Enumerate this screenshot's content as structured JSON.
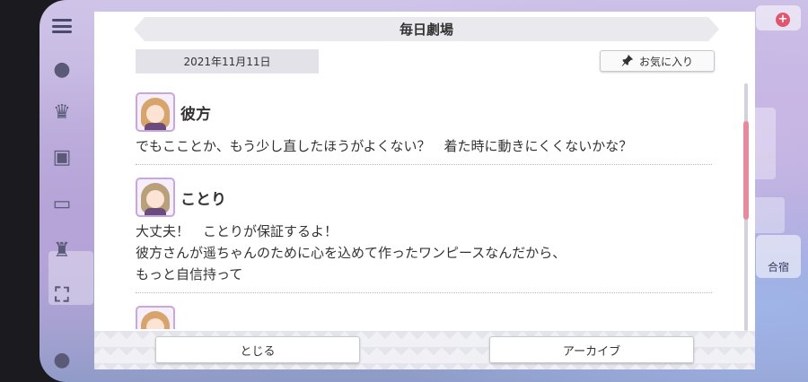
{
  "theme": {
    "accent_pink": "#e88a9e",
    "header_bg": "#e9e9ee",
    "text": "#333333"
  },
  "modal": {
    "title": "毎日劇場",
    "date": "2021年11月11日",
    "favorite_label": "お気に入り"
  },
  "entries": [
    {
      "speaker": "彼方",
      "avatar_hair": "#d7a46b",
      "lines": [
        "でもこことか、もう少し直したほうがよくない？　着た時に動きにくくないかな？"
      ]
    },
    {
      "speaker": "ことり",
      "avatar_hair": "#b8a07a",
      "lines": [
        "大丈夫！　ことりが保証するよ！",
        "彼方さんが遥ちゃんのために心を込めて作ったワンピースなんだから、",
        "もっと自信持って"
      ]
    }
  ],
  "footer": {
    "close_label": "とじる",
    "archive_label": "アーカイブ"
  },
  "background": {
    "right_button_label": "合宿"
  }
}
